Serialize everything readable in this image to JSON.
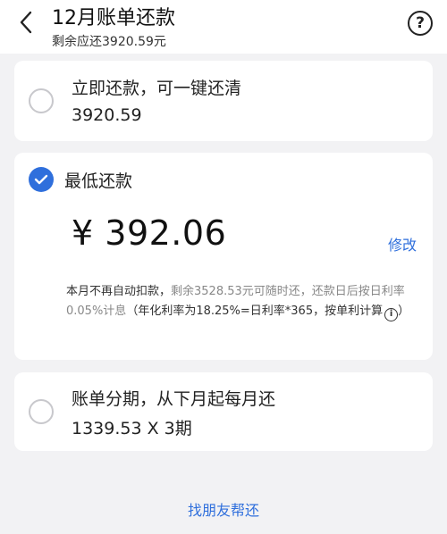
{
  "header": {
    "title": "12月账单还款",
    "subtitle": "剩余应还3920.59元",
    "help_symbol": "?"
  },
  "options": {
    "full": {
      "label": "立即还款，可一键还清",
      "amount": "3920.59"
    },
    "minimum": {
      "label": "最低还款",
      "currency": "¥",
      "amount": "392.06",
      "modify_label": "修改",
      "notice_part1": "本月不再自动扣款，",
      "notice_part2": "剩余3528.53元可随时还，还款日后按日利率0.05%计息",
      "notice_part3": "（年化利率为18.25%=日利率*365，按单利计算",
      "info_symbol": "i",
      "notice_close": "）"
    },
    "installment": {
      "label": "账单分期，从下月起每月还",
      "amount": "1339.53 X 3期"
    }
  },
  "footer": {
    "friend_link": "找朋友帮还"
  },
  "colors": {
    "accent": "#2f6fdc",
    "background": "#f2f2f4"
  }
}
